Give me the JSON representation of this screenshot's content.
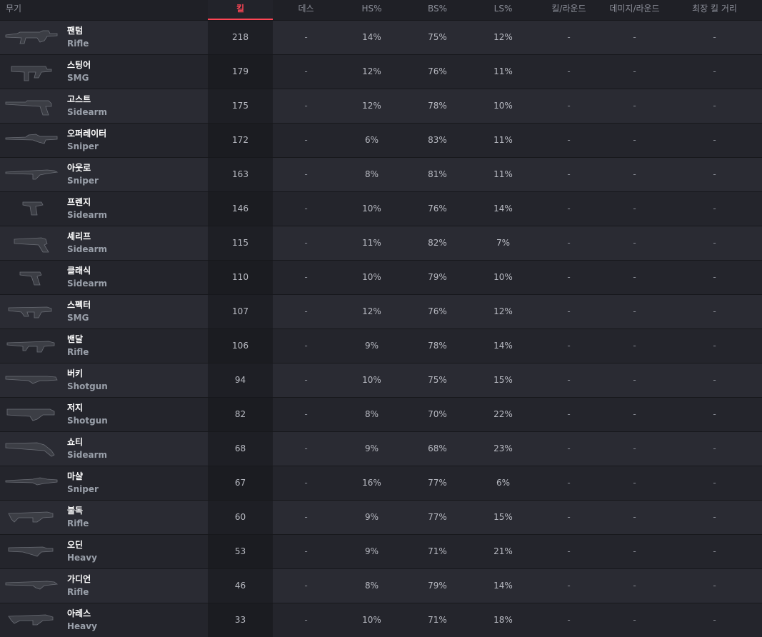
{
  "header": {
    "weapon": "무기",
    "kills": "킬",
    "deaths": "데스",
    "hs": "HS%",
    "bs": "BS%",
    "ls": "LS%",
    "kills_per_round": "킬/라운드",
    "damage_per_round": "데미지/라운드",
    "longest_kill": "최장 킬 거리"
  },
  "colors": {
    "accent": "#ff4655",
    "row_odd": "#2a2b33",
    "row_even": "#24252c",
    "background": "#1e1f25"
  },
  "rows": [
    {
      "name": "팬텀",
      "type": "Rifle",
      "icon": "phantom-icon",
      "kills": "218",
      "deaths": "-",
      "hs": "14%",
      "bs": "75%",
      "ls": "12%",
      "kr": "-",
      "dr": "-",
      "far": "-"
    },
    {
      "name": "스팅어",
      "type": "SMG",
      "icon": "stinger-icon",
      "kills": "179",
      "deaths": "-",
      "hs": "12%",
      "bs": "76%",
      "ls": "11%",
      "kr": "-",
      "dr": "-",
      "far": "-"
    },
    {
      "name": "고스트",
      "type": "Sidearm",
      "icon": "ghost-icon",
      "kills": "175",
      "deaths": "-",
      "hs": "12%",
      "bs": "78%",
      "ls": "10%",
      "kr": "-",
      "dr": "-",
      "far": "-"
    },
    {
      "name": "오퍼레이터",
      "type": "Sniper",
      "icon": "operator-icon",
      "kills": "172",
      "deaths": "-",
      "hs": "6%",
      "bs": "83%",
      "ls": "11%",
      "kr": "-",
      "dr": "-",
      "far": "-"
    },
    {
      "name": "아웃로",
      "type": "Sniper",
      "icon": "outlaw-icon",
      "kills": "163",
      "deaths": "-",
      "hs": "8%",
      "bs": "81%",
      "ls": "11%",
      "kr": "-",
      "dr": "-",
      "far": "-"
    },
    {
      "name": "프렌지",
      "type": "Sidearm",
      "icon": "frenzy-icon",
      "kills": "146",
      "deaths": "-",
      "hs": "10%",
      "bs": "76%",
      "ls": "14%",
      "kr": "-",
      "dr": "-",
      "far": "-"
    },
    {
      "name": "셰리프",
      "type": "Sidearm",
      "icon": "sheriff-icon",
      "kills": "115",
      "deaths": "-",
      "hs": "11%",
      "bs": "82%",
      "ls": "7%",
      "kr": "-",
      "dr": "-",
      "far": "-"
    },
    {
      "name": "클래식",
      "type": "Sidearm",
      "icon": "classic-icon",
      "kills": "110",
      "deaths": "-",
      "hs": "10%",
      "bs": "79%",
      "ls": "10%",
      "kr": "-",
      "dr": "-",
      "far": "-"
    },
    {
      "name": "스펙터",
      "type": "SMG",
      "icon": "spectre-icon",
      "kills": "107",
      "deaths": "-",
      "hs": "12%",
      "bs": "76%",
      "ls": "12%",
      "kr": "-",
      "dr": "-",
      "far": "-"
    },
    {
      "name": "밴달",
      "type": "Rifle",
      "icon": "vandal-icon",
      "kills": "106",
      "deaths": "-",
      "hs": "9%",
      "bs": "78%",
      "ls": "14%",
      "kr": "-",
      "dr": "-",
      "far": "-"
    },
    {
      "name": "버키",
      "type": "Shotgun",
      "icon": "bucky-icon",
      "kills": "94",
      "deaths": "-",
      "hs": "10%",
      "bs": "75%",
      "ls": "15%",
      "kr": "-",
      "dr": "-",
      "far": "-"
    },
    {
      "name": "저지",
      "type": "Shotgun",
      "icon": "judge-icon",
      "kills": "82",
      "deaths": "-",
      "hs": "8%",
      "bs": "70%",
      "ls": "22%",
      "kr": "-",
      "dr": "-",
      "far": "-"
    },
    {
      "name": "쇼티",
      "type": "Sidearm",
      "icon": "shorty-icon",
      "kills": "68",
      "deaths": "-",
      "hs": "9%",
      "bs": "68%",
      "ls": "23%",
      "kr": "-",
      "dr": "-",
      "far": "-"
    },
    {
      "name": "마샬",
      "type": "Sniper",
      "icon": "marshal-icon",
      "kills": "67",
      "deaths": "-",
      "hs": "16%",
      "bs": "77%",
      "ls": "6%",
      "kr": "-",
      "dr": "-",
      "far": "-"
    },
    {
      "name": "불독",
      "type": "Rifle",
      "icon": "bulldog-icon",
      "kills": "60",
      "deaths": "-",
      "hs": "9%",
      "bs": "77%",
      "ls": "15%",
      "kr": "-",
      "dr": "-",
      "far": "-"
    },
    {
      "name": "오딘",
      "type": "Heavy",
      "icon": "odin-icon",
      "kills": "53",
      "deaths": "-",
      "hs": "9%",
      "bs": "71%",
      "ls": "21%",
      "kr": "-",
      "dr": "-",
      "far": "-"
    },
    {
      "name": "가디언",
      "type": "Rifle",
      "icon": "guardian-icon",
      "kills": "46",
      "deaths": "-",
      "hs": "8%",
      "bs": "79%",
      "ls": "14%",
      "kr": "-",
      "dr": "-",
      "far": "-"
    },
    {
      "name": "아레스",
      "type": "Heavy",
      "icon": "ares-icon",
      "kills": "33",
      "deaths": "-",
      "hs": "10%",
      "bs": "71%",
      "ls": "18%",
      "kr": "-",
      "dr": "-",
      "far": "-"
    }
  ]
}
